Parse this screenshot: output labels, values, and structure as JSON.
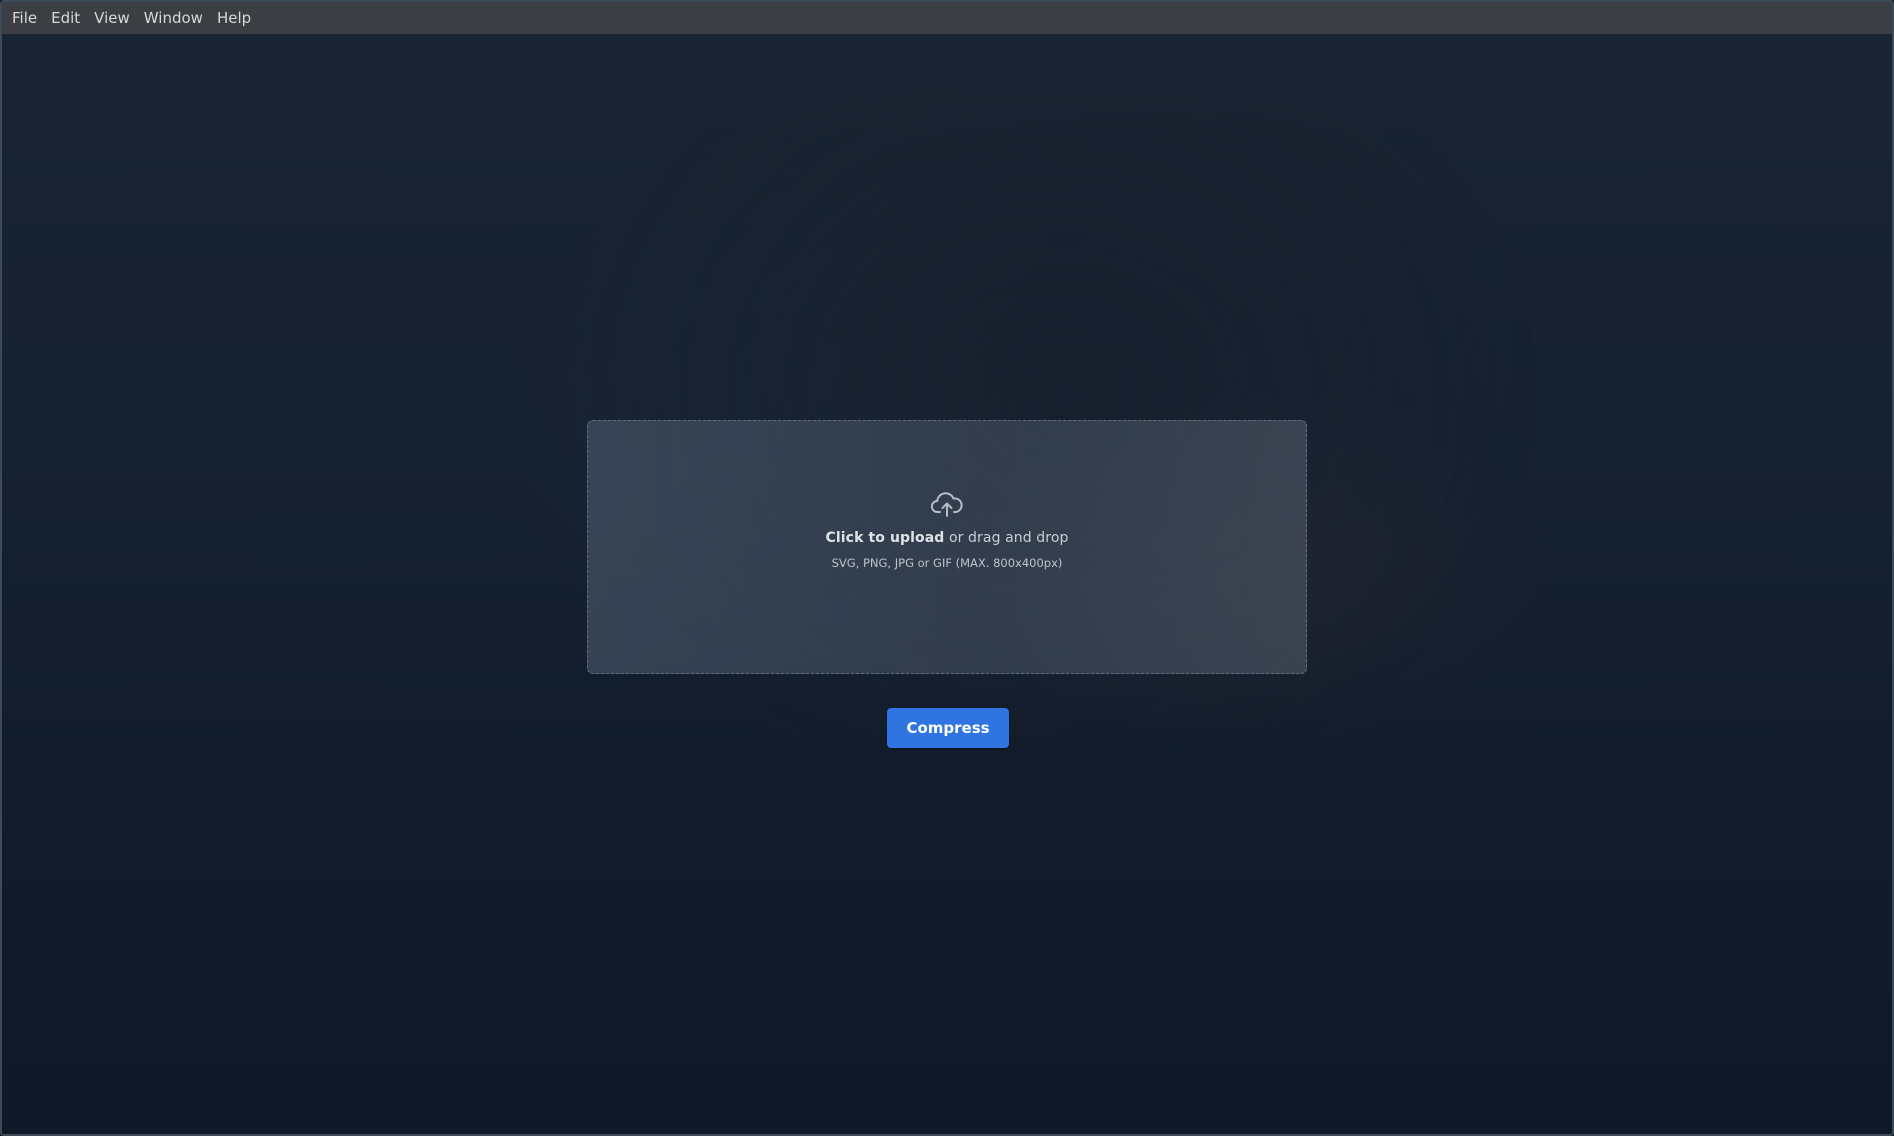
{
  "menubar": {
    "items": [
      {
        "label": "File"
      },
      {
        "label": "Edit"
      },
      {
        "label": "View"
      },
      {
        "label": "Window"
      },
      {
        "label": "Help"
      }
    ]
  },
  "dropzone": {
    "icon": "cloud-upload-icon",
    "primary_strong": "Click to upload",
    "primary_rest": " or drag and drop",
    "hint": "SVG, PNG, JPG or GIF (MAX. 800x400px)"
  },
  "actions": {
    "compress_label": "Compress"
  },
  "colors": {
    "menubar_bg": "#3b3f43",
    "accent": "#2f74e0",
    "background": "#162131"
  }
}
